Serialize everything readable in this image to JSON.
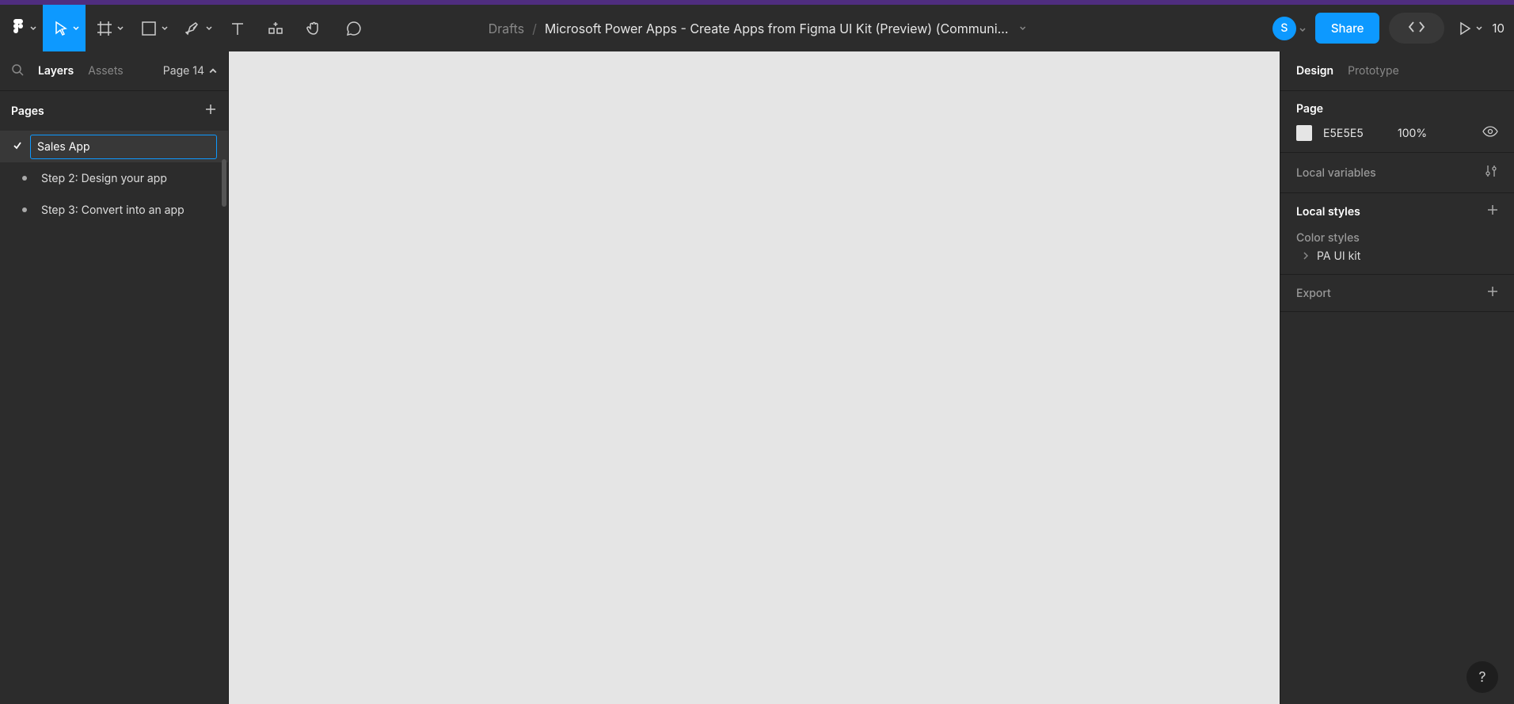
{
  "toolbar": {
    "drafts_label": "Drafts",
    "title": "Microsoft Power Apps - Create Apps from Figma UI Kit (Preview) (Communi…",
    "share_label": "Share",
    "avatar_initial": "S",
    "zoom": "10"
  },
  "left_panel": {
    "tabs": {
      "layers": "Layers",
      "assets": "Assets"
    },
    "page_indicator": "Page 14",
    "pages_header": "Pages",
    "pages": {
      "editing_value": "Sales App",
      "step2": "Step 2: Design your app",
      "step3": "Step 3: Convert into an app"
    }
  },
  "right_panel": {
    "tabs": {
      "design": "Design",
      "prototype": "Prototype"
    },
    "page_section": {
      "title": "Page",
      "hex": "E5E5E5",
      "opacity": "100%"
    },
    "local_variables": "Local variables",
    "local_styles": "Local styles",
    "color_styles": "Color styles",
    "style_item": "PA UI kit",
    "export": "Export"
  },
  "help_label": "?"
}
